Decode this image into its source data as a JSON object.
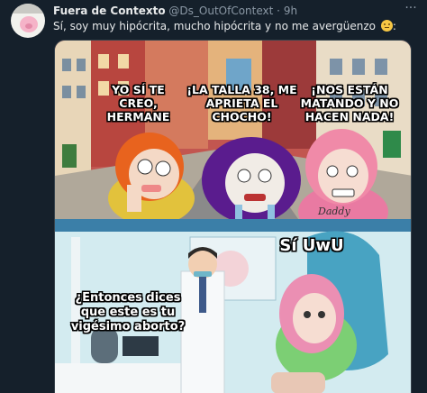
{
  "tweet": {
    "display_name": "Fuera de Contexto",
    "handle": "@Ds_OutOfContext",
    "separator": "·",
    "time": "9h",
    "text": "Sí, soy muy hipócrita, mucho hipócrita y no me avergüenzo",
    "text_suffix": ":",
    "more_icon": "more-dots-icon"
  },
  "meme": {
    "top_captions": [
      "YO SÍ TE\nCREO,\nHERMANE",
      "¡LA TALLA 38, ME\nAPRIETA EL\nCHOCHO!",
      "¡NOS ESTÁN\nMATANDO Y NO\nHACEN NADA!"
    ],
    "shirt_text": "Daddy",
    "bottom_question": "¿Entonces dices\nque este es tu\nvigésimo aborto?",
    "bottom_answer": "Sí UwU"
  },
  "colors": {
    "background": "#15202b",
    "text_primary": "#e7e9ea",
    "text_secondary": "#8b98a5"
  }
}
